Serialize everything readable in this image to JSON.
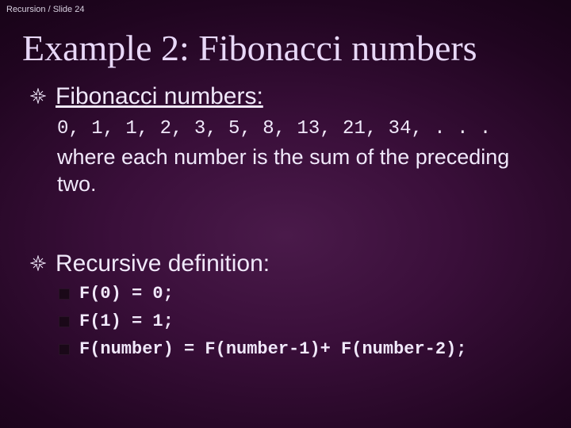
{
  "header": "Recursion / Slide 24",
  "title": "Example 2: Fibonacci numbers",
  "section1": {
    "heading": "Fibonacci numbers:",
    "sequence": "0, 1, 1, 2, 3, 5, 8, 13, 21, 34, . . .",
    "description": "where each number is the sum of the preceding two."
  },
  "section2": {
    "heading": "Recursive definition:",
    "items": [
      "F(0) = 0;",
      "F(1) = 1;",
      "F(number) = F(number-1)+ F(number-2);"
    ]
  }
}
